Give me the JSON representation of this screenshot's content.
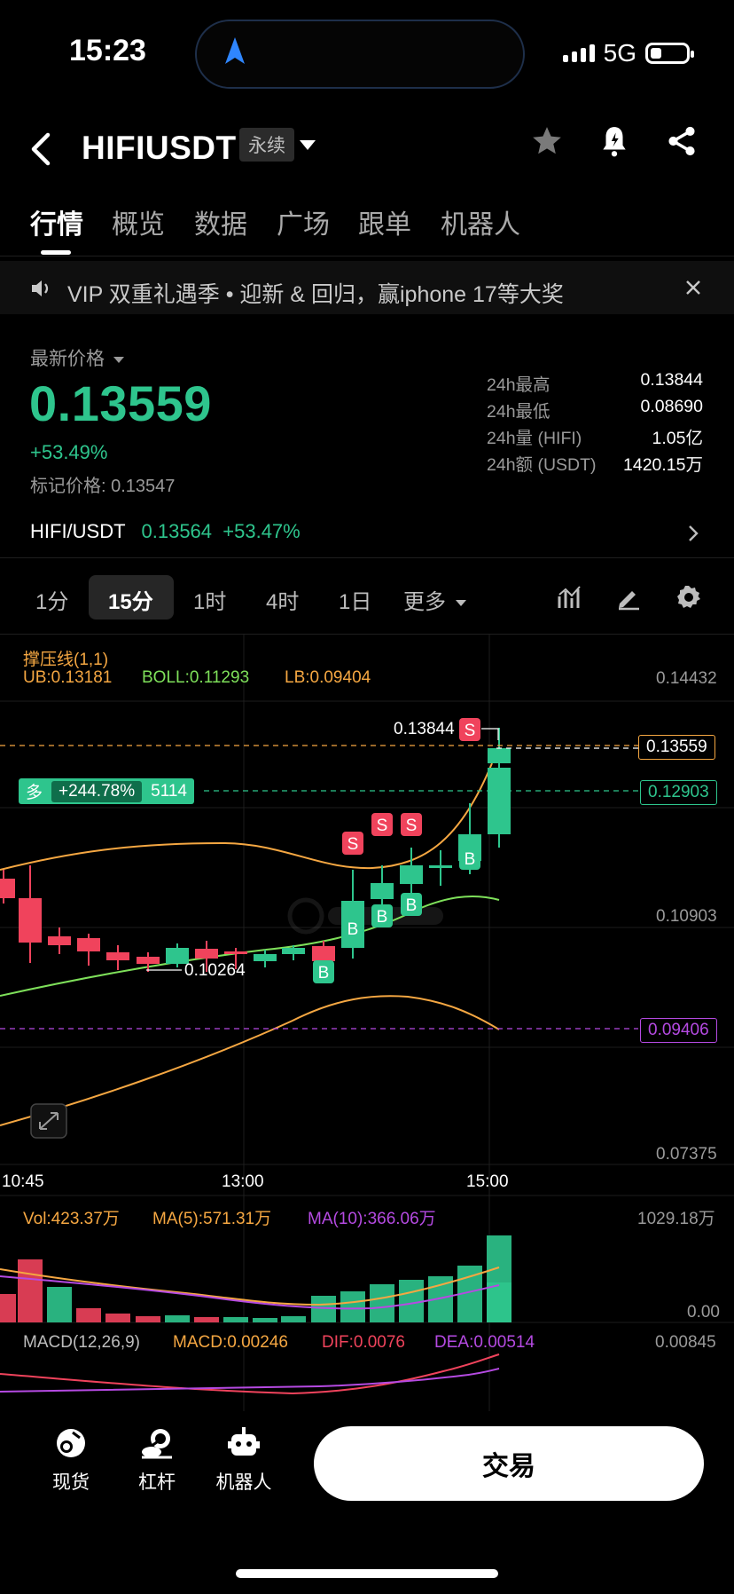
{
  "status_bar": {
    "time": "15:23",
    "network": "5G"
  },
  "header": {
    "title": "HIFIUSDT",
    "badge": "永续"
  },
  "tabs": [
    "行情",
    "概览",
    "数据",
    "广场",
    "跟单",
    "机器人"
  ],
  "banner": {
    "text": "VIP 双重礼遇季 • 迎新 & 回归，赢iphone 17等大奖"
  },
  "price": {
    "label": "最新价格",
    "last": "0.13559",
    "change": "+53.49%",
    "mark_label": "标记价格:",
    "mark": "0.13547"
  },
  "stats": [
    {
      "k": "24h最高",
      "v": "0.13844"
    },
    {
      "k": "24h最低",
      "v": "0.08690"
    },
    {
      "k": "24h量 (HIFI)",
      "v": "1.05亿"
    },
    {
      "k": "24h额 (USDT)",
      "v": "1420.15万"
    }
  ],
  "spot": {
    "pair": "HIFI/USDT",
    "price": "0.13564",
    "change": "+53.47%"
  },
  "timeframes": [
    "1分",
    "15分",
    "1时",
    "4时",
    "1日",
    "更多"
  ],
  "chart": {
    "indicator_title": "撑压线(1,1)",
    "ub": "UB:0.13181",
    "boll": "BOLL:0.11293",
    "lb": "LB:0.09404",
    "y_labels": [
      "0.14432",
      "0.10903",
      "0.07375"
    ],
    "x_labels": [
      "10:45",
      "13:00",
      "15:00"
    ],
    "high_marker": "0.13844",
    "low_marker": "0.10264",
    "last_price_box": "0.13559",
    "position_box": "0.12903",
    "lb_box": "0.09406",
    "position": {
      "side": "多",
      "pnl": "+244.78%",
      "size": "5114"
    }
  },
  "volume": {
    "vol": "Vol:423.37万",
    "ma5": "MA(5):571.31万",
    "ma10": "MA(10):366.06万",
    "max": "1029.18万",
    "min": "0.00"
  },
  "macd": {
    "title": "MACD(12,26,9)",
    "macd": "MACD:0.00246",
    "dif": "DIF:0.0076",
    "dea": "DEA:0.00514",
    "max": "0.00845"
  },
  "bottom_nav": {
    "spot": "现货",
    "leverage": "杠杆",
    "bot": "机器人",
    "trade": "交易"
  },
  "colors": {
    "up": "#2ec58d",
    "down": "#f0435c",
    "accent_orange": "#f5a742",
    "purple": "#b54ae2"
  }
}
